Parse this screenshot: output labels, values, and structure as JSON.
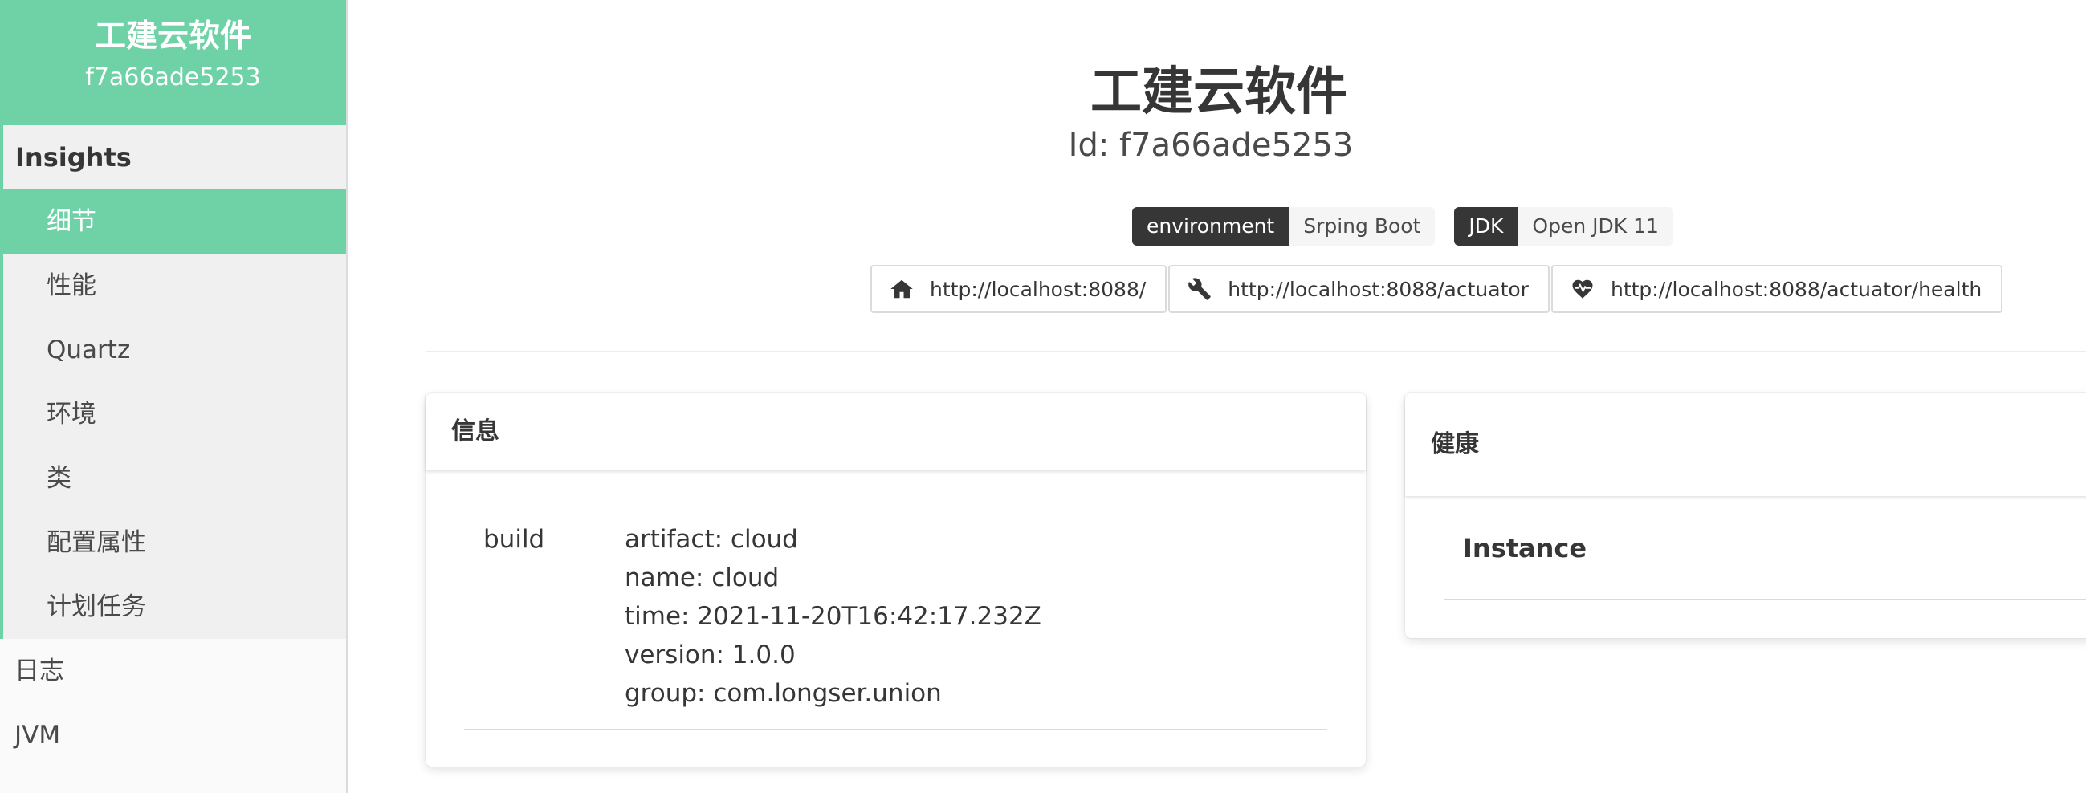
{
  "sidebar": {
    "app_name": "工建云软件",
    "app_id": "f7a66ade5253",
    "group_title": "Insights",
    "group_items": [
      {
        "label": "细节"
      },
      {
        "label": "性能"
      },
      {
        "label": "Quartz"
      },
      {
        "label": "环境"
      },
      {
        "label": "类"
      },
      {
        "label": "配置属性"
      },
      {
        "label": "计划任务"
      }
    ],
    "items": [
      {
        "label": "日志"
      },
      {
        "label": "JVM"
      }
    ]
  },
  "header": {
    "title": "工建云软件",
    "id_text": "Id: f7a66ade5253"
  },
  "tags": [
    {
      "key": "environment",
      "value": "Srping Boot"
    },
    {
      "key": "JDK",
      "value": "Open JDK 11"
    }
  ],
  "links": [
    {
      "icon": "home-icon",
      "url": "http://localhost:8088/"
    },
    {
      "icon": "wrench-icon",
      "url": "http://localhost:8088/actuator"
    },
    {
      "icon": "heartbeat-icon",
      "url": "http://localhost:8088/actuator/health"
    }
  ],
  "info_card": {
    "title": "信息",
    "key": "build",
    "values": [
      "artifact: cloud",
      "name: cloud",
      "time: 2021-11-20T16:42:17.232Z",
      "version: 1.0.0",
      "group: com.longser.union"
    ]
  },
  "health_card": {
    "title": "健康",
    "row_label": "Instance"
  },
  "colors": {
    "accent": "#6fd1a6",
    "dark_tag": "#363636"
  }
}
